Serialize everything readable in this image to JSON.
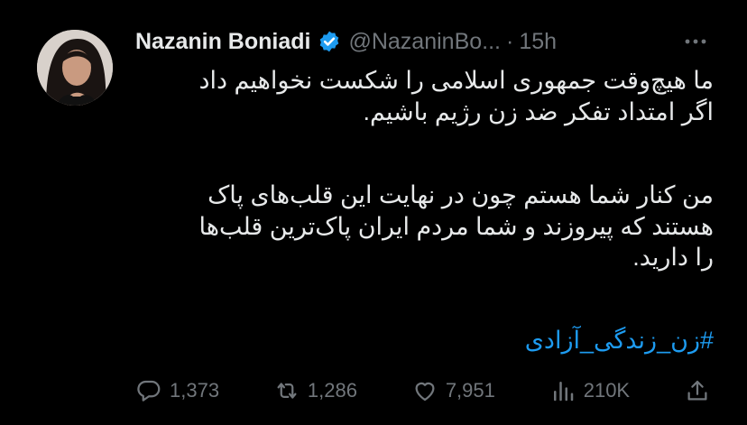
{
  "tweet": {
    "author_name": "Nazanin Boniadi",
    "handle": "@NazaninBo...",
    "dot": "·",
    "time": "15h",
    "body_lines_1": [
      "ما هیچ‌وقت جمهوری اسلامی را شکست نخواهیم داد",
      "اگر امتداد تفکر ضد زن رژیم باشیم."
    ],
    "body_lines_2": [
      "من کنار شما هستم چون در نهایت این قلب‌های پاک",
      "هستند که پیروزند و شما مردم ایران پاک‌ترین قلب‌ها",
      "را دارید."
    ],
    "hashtag": "#زن_زندگی_آزادی"
  },
  "actions": {
    "reply_count": "1,373",
    "retweet_count": "1,286",
    "like_count": "7,951",
    "view_count": "210K"
  },
  "icons": {
    "verified": "verified-badge-icon",
    "more": "more-icon",
    "reply": "reply-icon",
    "retweet": "retweet-icon",
    "like": "heart-icon",
    "views": "views-icon",
    "share": "share-icon"
  },
  "colors": {
    "background": "#000000",
    "text": "#e7e9ea",
    "muted": "#71767b",
    "accent": "#1d9bf0"
  }
}
